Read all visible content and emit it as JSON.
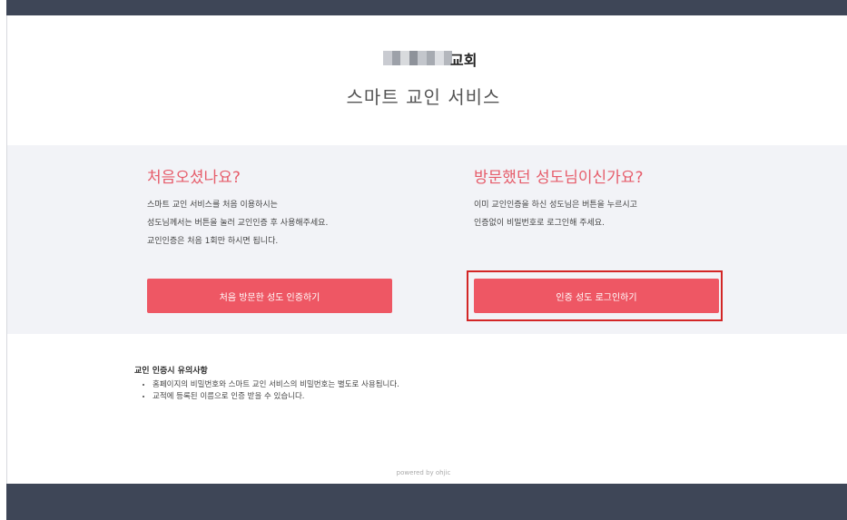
{
  "header": {
    "church_name": "교회",
    "service_title": "스마트 교인 서비스"
  },
  "first_visit": {
    "title": "처음오셨나요?",
    "description": "스마트 교인 서비스를 처음 이용하시는\n성도님께서는 버튼을 눌러 교인인증 후 사용해주세요.\n교인인증은 처음 1회만 하시면 됩니다.",
    "button_label": "처음 방문한 성도 인증하기"
  },
  "returning": {
    "title": "방문했던 성도님이신가요?",
    "description": "이미 교인인증을 하신 성도님은 버튼을 누르시고\n인증없이 비밀번호로 로그인해 주세요.",
    "button_label": "인증 성도 로그인하기"
  },
  "notes": {
    "title": "교인 인증시 유의사항",
    "items": [
      "홈페이지의 비밀번호와 스마트 교인 서비스의 비밀번호는 별도로 사용됩니다.",
      "교적에 등록된 이름으로 인증 받을 수 있습니다."
    ]
  },
  "footer": {
    "powered_by": "powered by ohjic"
  },
  "colors": {
    "accent": "#ee5764",
    "title_pink": "#e65c6a",
    "dark_bar": "#3e4657",
    "panel_bg": "#f2f3f7",
    "highlight_border": "#d32626"
  }
}
